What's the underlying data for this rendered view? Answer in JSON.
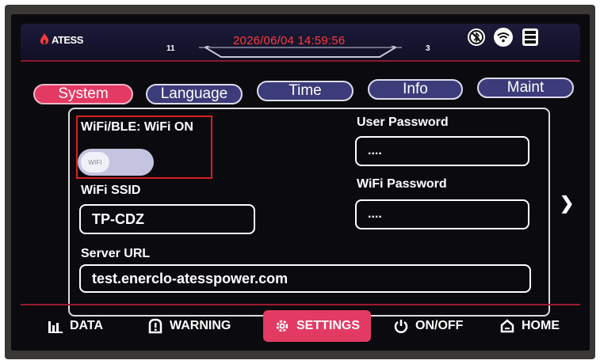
{
  "header": {
    "logo_text": "ATESS",
    "left_number": "11",
    "datetime": "2026/06/04 14:59:56",
    "right_number": "3"
  },
  "tabs": [
    {
      "label": "System",
      "active": true
    },
    {
      "label": "Language",
      "active": false
    },
    {
      "label": "Time",
      "active": false
    },
    {
      "label": "Info",
      "active": false
    },
    {
      "label": "Maint",
      "active": false
    }
  ],
  "system": {
    "wifi_ble_label": "WiFi/BLE: WiFi ON",
    "toggle_text": "WIFI",
    "wifi_ssid_label": "WiFi SSID",
    "wifi_ssid_value": "TP-CDZ",
    "server_url_label": "Server URL",
    "server_url_value": "test.enerclo-atesspower.com",
    "user_password_label": "User Password",
    "user_password_value": "....",
    "wifi_password_label": "WiFi Password",
    "wifi_password_value": "...."
  },
  "bottom_nav": [
    {
      "label": "DATA",
      "icon": "bar-chart-icon",
      "active": false
    },
    {
      "label": "WARNING",
      "icon": "warning-icon",
      "active": false
    },
    {
      "label": "SETTINGS",
      "icon": "gear-icon",
      "active": true
    },
    {
      "label": "ON/OFF",
      "icon": "power-icon",
      "active": false
    },
    {
      "label": "HOME",
      "icon": "home-icon",
      "active": false
    }
  ],
  "colors": {
    "accent": "#e33a64",
    "tab_bg": "#3c3c7a",
    "datetime": "#ff3b3b",
    "highlight_box": "#d8201f"
  }
}
